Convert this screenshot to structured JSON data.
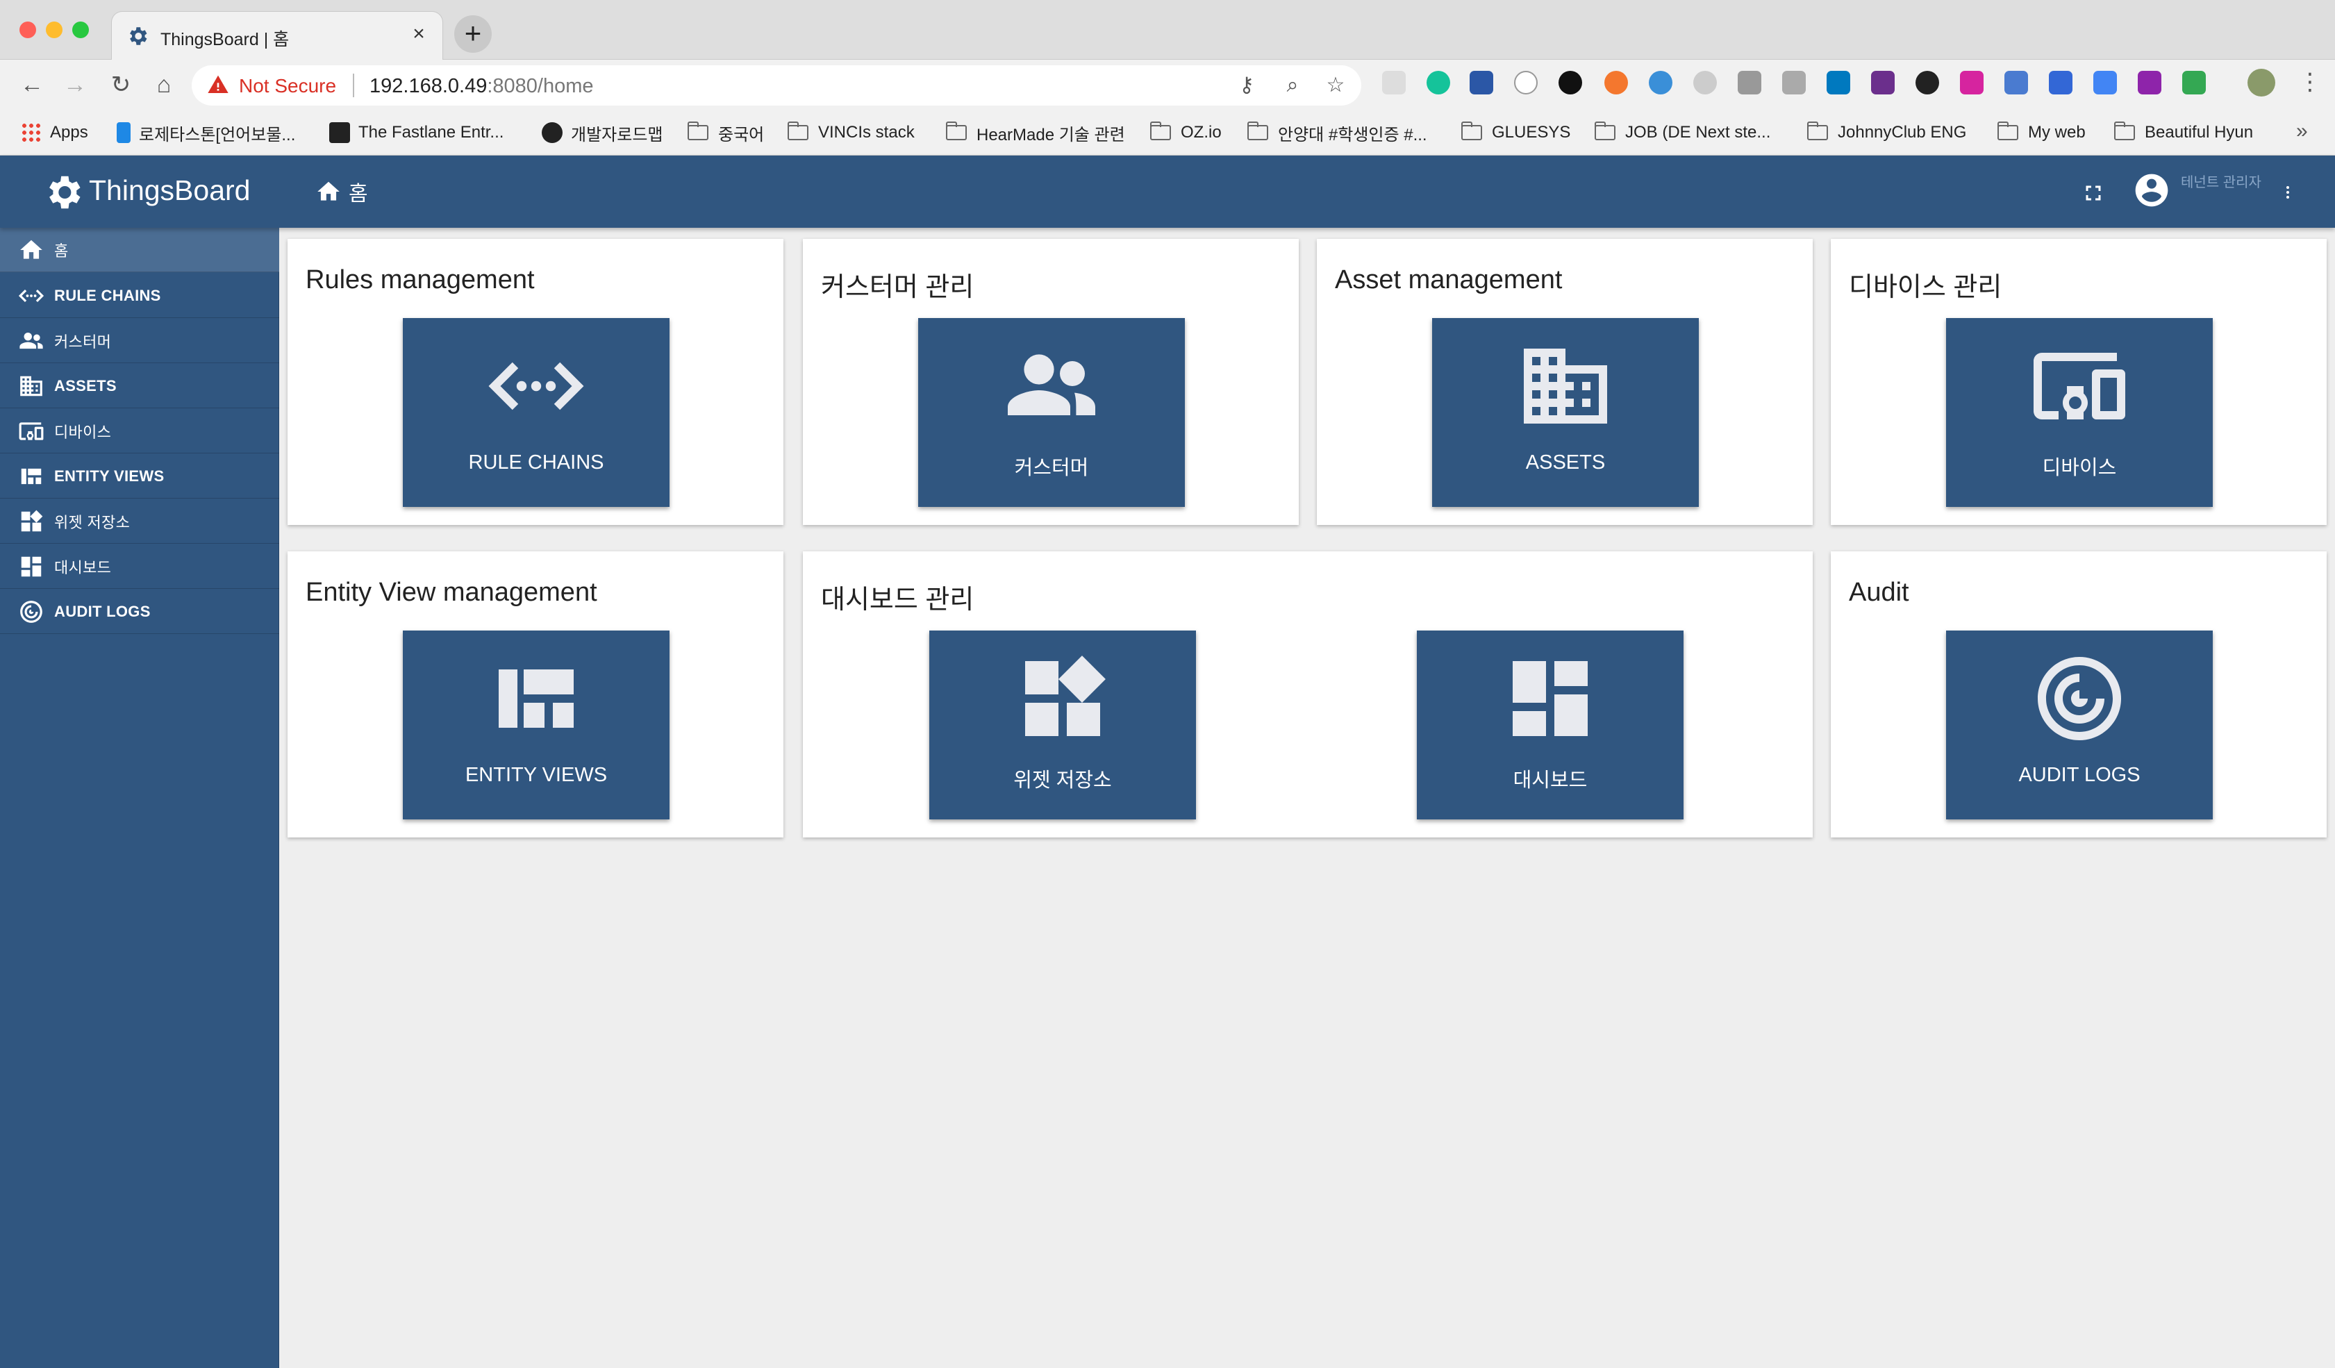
{
  "browser": {
    "tab_title": "ThingsBoard | 홈",
    "tab_close": "×",
    "new_tab": "+",
    "security_label": "Not Secure",
    "url_host": "192.168.0.49",
    "url_rest": ":8080/home",
    "more_bookmarks": "»",
    "bookmarks": [
      {
        "label": "Apps",
        "icon": "apps-grid-icon"
      },
      {
        "label": "로제타스톤[언어보물...",
        "icon": "site-icon"
      },
      {
        "label": "The Fastlane Entr...",
        "icon": "site-icon"
      },
      {
        "label": "개발자로드맵",
        "icon": "github-icon"
      },
      {
        "label": "중국어",
        "icon": "folder-icon"
      },
      {
        "label": "VINCIs stack",
        "icon": "folder-icon"
      },
      {
        "label": "HearMade 기술 관련",
        "icon": "folder-icon"
      },
      {
        "label": "OZ.io",
        "icon": "folder-icon"
      },
      {
        "label": "안양대 #학생인증 #...",
        "icon": "folder-icon"
      },
      {
        "label": "GLUESYS",
        "icon": "folder-icon"
      },
      {
        "label": "JOB (DE Next ste...",
        "icon": "folder-icon"
      },
      {
        "label": "JohnnyClub ENG",
        "icon": "folder-icon"
      },
      {
        "label": "My web",
        "icon": "folder-icon"
      },
      {
        "label": "Beautiful Hyun",
        "icon": "folder-icon"
      }
    ]
  },
  "app": {
    "name": "ThingsBoard",
    "breadcrumb": "홈",
    "user_label": "테넌트 관리자"
  },
  "sidebar": {
    "items": [
      {
        "label": "홈",
        "icon": "home-icon"
      },
      {
        "label": "RULE CHAINS",
        "icon": "rule-chains-icon"
      },
      {
        "label": "커스터머",
        "icon": "customers-icon"
      },
      {
        "label": "ASSETS",
        "icon": "assets-icon"
      },
      {
        "label": "디바이스",
        "icon": "devices-icon"
      },
      {
        "label": "ENTITY VIEWS",
        "icon": "entity-views-icon"
      },
      {
        "label": "위젯 저장소",
        "icon": "widgets-icon"
      },
      {
        "label": "대시보드",
        "icon": "dashboards-icon"
      },
      {
        "label": "AUDIT LOGS",
        "icon": "audit-logs-icon"
      }
    ]
  },
  "cards": [
    {
      "title": "Rules management",
      "tiles": [
        {
          "label": "RULE CHAINS",
          "icon": "rule-chains-icon"
        }
      ]
    },
    {
      "title": "커스터머 관리",
      "tiles": [
        {
          "label": "커스터머",
          "icon": "customers-icon"
        }
      ]
    },
    {
      "title": "Asset management",
      "tiles": [
        {
          "label": "ASSETS",
          "icon": "assets-icon"
        }
      ]
    },
    {
      "title": "디바이스 관리",
      "tiles": [
        {
          "label": "디바이스",
          "icon": "devices-icon"
        }
      ]
    },
    {
      "title": "Entity View management",
      "tiles": [
        {
          "label": "ENTITY VIEWS",
          "icon": "entity-views-icon"
        }
      ]
    },
    {
      "title": "대시보드 관리",
      "tiles": [
        {
          "label": "위젯 저장소",
          "icon": "widgets-icon"
        },
        {
          "label": "대시보드",
          "icon": "dashboards-icon"
        }
      ]
    },
    {
      "title": "Audit",
      "tiles": [
        {
          "label": "AUDIT LOGS",
          "icon": "audit-logs-icon"
        }
      ]
    }
  ],
  "colors": {
    "primary": "#305680",
    "sidebar_active": "#4b6d93",
    "tile_icon": "#e8eaef",
    "content_bg": "#eeeeee",
    "warning": "#d93025"
  }
}
